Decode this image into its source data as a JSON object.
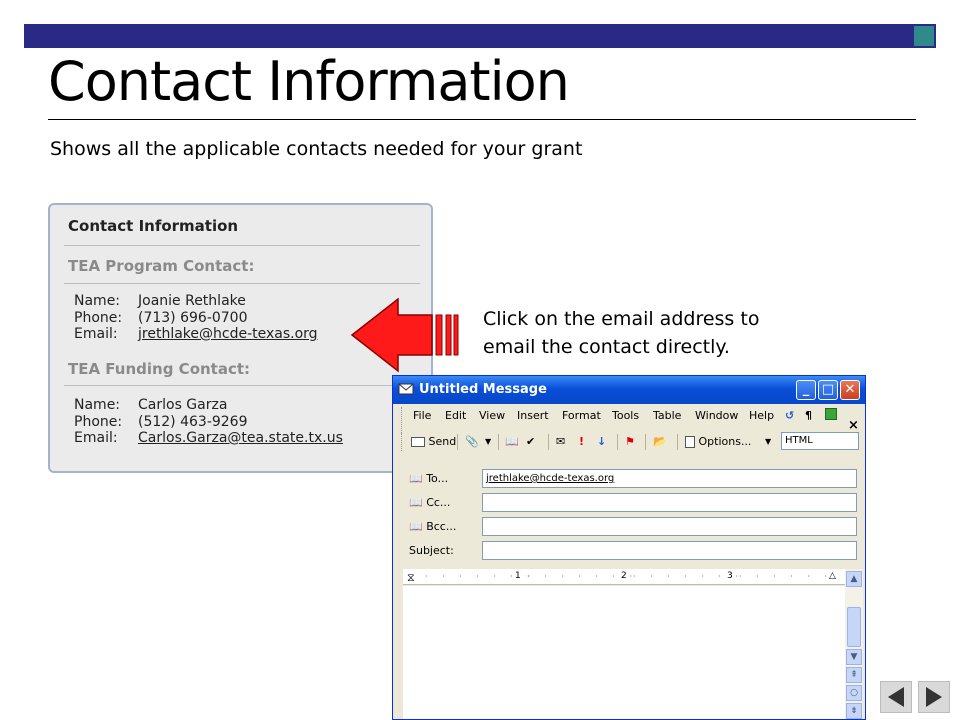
{
  "slide": {
    "title": "Contact Information",
    "subtitle": "Shows all the applicable contacts needed for your grant",
    "instruction_line1": "Click on the email address to",
    "instruction_line2": "email the contact directly."
  },
  "card": {
    "heading": "Contact Information",
    "program_heading": "TEA Program Contact:",
    "funding_heading": "TEA Funding Contact:",
    "labels": {
      "name": "Name:",
      "phone": "Phone:",
      "email": "Email:"
    },
    "program_contact": {
      "name": "Joanie Rethlake",
      "phone": "(713) 696-0700",
      "email": "jrethlake@hcde-texas.org"
    },
    "funding_contact": {
      "name": "Carlos Garza",
      "phone": "(512) 463-9269",
      "email": "Carlos.Garza@tea.state.tx.us"
    }
  },
  "email_window": {
    "title": "Untitled Message",
    "menu": [
      "File",
      "Edit",
      "View",
      "Insert",
      "Format",
      "Tools",
      "Table",
      "Window",
      "Help"
    ],
    "toolbar": {
      "send": "Send",
      "options": "Options...",
      "format": "HTML"
    },
    "fields": {
      "to_label": "To...",
      "to_value": "jrethlake@hcde-texas.org",
      "cc_label": "Cc...",
      "bcc_label": "Bcc...",
      "subject_label": "Subject:"
    },
    "ruler_marks": [
      "1",
      "2",
      "3"
    ]
  },
  "colors": {
    "title_bar": "#2a2a86",
    "accent": "#2f8a8a",
    "arrow": "#ff0000"
  }
}
